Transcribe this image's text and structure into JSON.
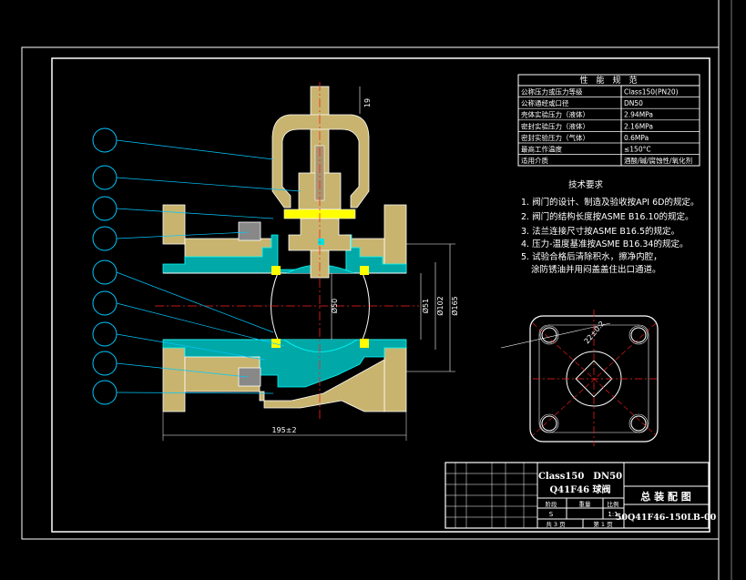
{
  "colors": {
    "background": "#000000",
    "line": "#ffffff",
    "body_fill": "#c8b46e",
    "seal_yellow": "#ffff00",
    "section_cyan": "#00e0e0",
    "dim_red": "#ff2020",
    "balloon_cyan": "#00c8ff"
  },
  "spec_table": {
    "title": "性　能　规　范",
    "rows": [
      {
        "name": "公称压力或压力等级",
        "value": "Class150(PN20)"
      },
      {
        "name": "公称通经或口径",
        "value": "DN50"
      },
      {
        "name": "壳体实验压力（液体）",
        "value": "2.94MPa"
      },
      {
        "name": "密封实验压力（液体）",
        "value": "2.16MPa"
      },
      {
        "name": "密封实验压力（气体）",
        "value": "0.6MPa"
      },
      {
        "name": "最高工作温度",
        "value": "≤150°C"
      },
      {
        "name": "适用介质",
        "value": "酒酸/碱/腐蚀性/氧化剂"
      }
    ]
  },
  "tech_requirements": {
    "title": "技术要求",
    "items": [
      "1. 阀门的设计、制造及验收按API 6D的规定。",
      "2. 阀门的结构长度按ASME B16.10的规定。",
      "3. 法兰连接尺寸按ASME B16.5的规定。",
      "4. 压力-温度基准按ASME B16.34的规定。",
      "5. 试验合格后清除积水，擦净内腔，",
      "涂防锈油并用闷盖盖住出口通道。"
    ]
  },
  "dimensions": {
    "top": "19",
    "bore": "Ø50",
    "seat": "Ø51",
    "raised_face": "Ø102",
    "flange": "Ø165",
    "length": "195±2",
    "top_view_stem": "22±0.2"
  },
  "title_block": {
    "product_line1": "Class150　DN50",
    "product_line2": "Q41F46 球阀",
    "drawing_name": "总 装 配 图",
    "drawing_number": "50Q41F46-150LB-00",
    "col_stage": "阶段",
    "col_weight": "重量",
    "col_scale": "比例",
    "scale": "1:1",
    "stage_value": "S",
    "sheets_total": "共 3 页",
    "sheet_current": "第 1 页"
  },
  "balloons": [
    "",
    "",
    "",
    "",
    "",
    "",
    "",
    "",
    ""
  ]
}
